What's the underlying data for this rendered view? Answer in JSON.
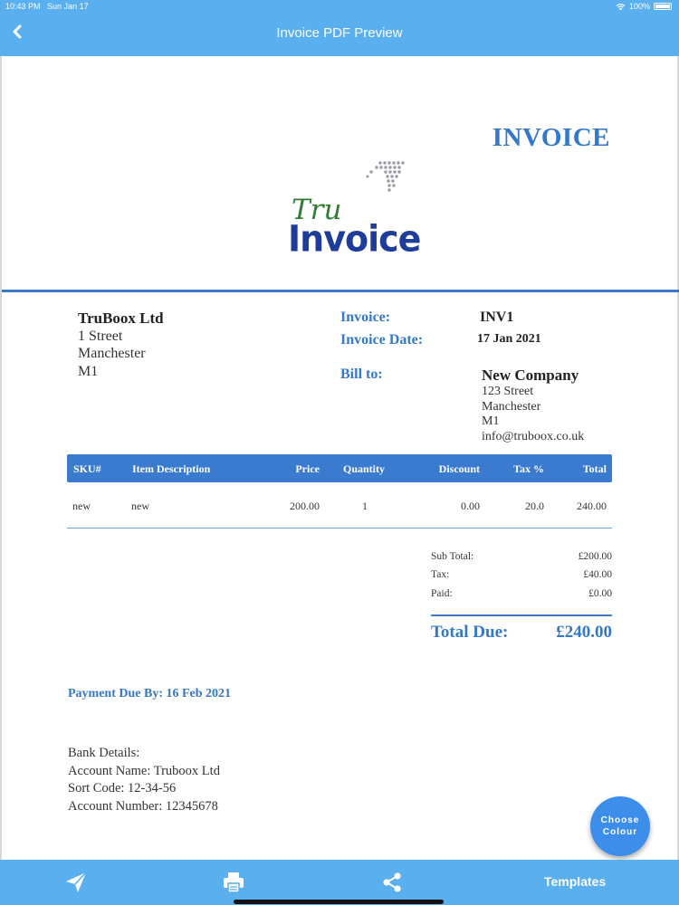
{
  "status": {
    "time": "10:43 PM",
    "date": "Sun Jan 17",
    "battery": "100%"
  },
  "nav": {
    "title": "Invoice PDF Preview"
  },
  "invoice": {
    "heading": "INVOICE",
    "logo_top": "Tru",
    "logo_bottom": "Invoice",
    "from": {
      "name": "TruBoox Ltd",
      "line1": "1 Street",
      "line2": "Manchester",
      "line3": "M1"
    },
    "invoice_label": "Invoice:",
    "invoice_number": "INV1",
    "date_label": "Invoice Date:",
    "date_value": "17 Jan 2021",
    "billto_label": "Bill to:",
    "billto": {
      "name": "New Company",
      "line1": "123 Street",
      "line2": "Manchester",
      "line3": "M1",
      "email": "info@truboox.co.uk"
    },
    "columns": [
      "SKU#",
      "Item Description",
      "Price",
      "Quantity",
      "Discount",
      "Tax %",
      "Total"
    ],
    "items": [
      {
        "sku": "new",
        "description": "new",
        "price": "200.00",
        "quantity": "1",
        "discount": "0.00",
        "tax": "20.0",
        "total": "240.00"
      }
    ],
    "totals": {
      "subtotal_label": "Sub Total:",
      "subtotal": "£200.00",
      "tax_label": "Tax:",
      "tax": "£40.00",
      "paid_label": "Paid:",
      "paid": "£0.00",
      "due_label": "Total Due:",
      "due": "£240.00"
    },
    "payment_due": "Payment Due By: 16 Feb 2021",
    "bank": {
      "title": "Bank Details:",
      "account_name": "Account Name: Truboox Ltd",
      "sort_code": "Sort Code: 12-34-56",
      "account_number": "Account Number: 12345678"
    }
  },
  "fab": {
    "line1": "Choose",
    "line2": "Colour"
  },
  "tabbar": {
    "templates_label": "Templates"
  },
  "colors": {
    "accent": "#5aafee",
    "invoice_blue": "#3478c6",
    "table_header": "#3a7bd0",
    "fab": "#3c8eea"
  }
}
